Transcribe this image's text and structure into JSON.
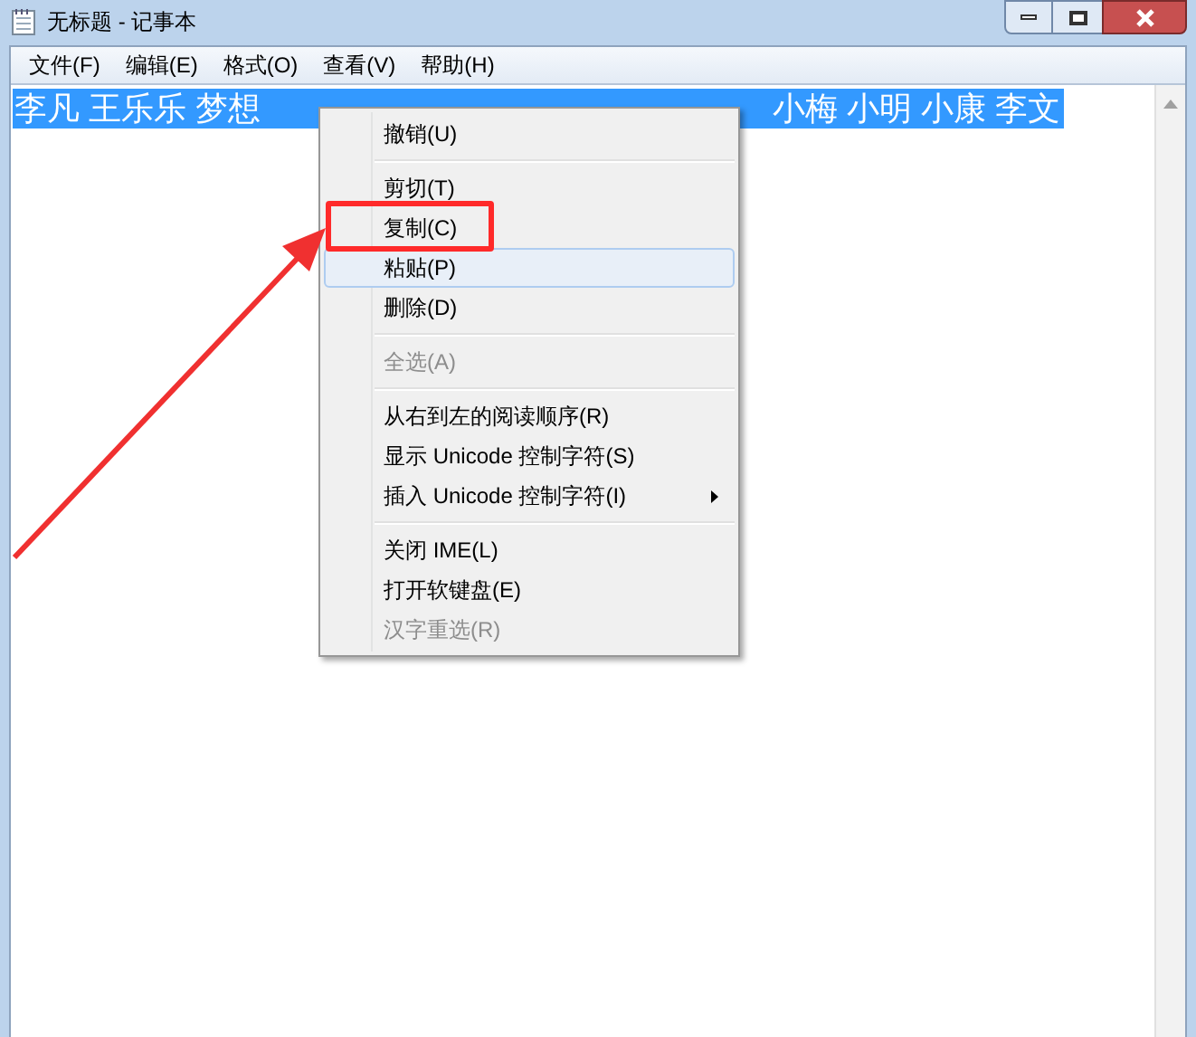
{
  "window": {
    "title": "无标题 - 记事本"
  },
  "menu_bar": [
    "文件(F)",
    "编辑(E)",
    "格式(O)",
    "查看(V)",
    "帮助(H)"
  ],
  "editor": {
    "selected": true,
    "text_segments": [
      "李凡 王乐乐 梦想",
      "小梅 小明 小康 李文"
    ]
  },
  "context_menu": [
    {
      "kind": "item",
      "label": "撤销(U)",
      "disabled": false,
      "selected": false,
      "submenu": false
    },
    {
      "kind": "separator"
    },
    {
      "kind": "item",
      "label": "剪切(T)",
      "disabled": false,
      "selected": false,
      "submenu": false
    },
    {
      "kind": "item",
      "label": "复制(C)",
      "disabled": false,
      "selected": false,
      "submenu": false,
      "annotated": true
    },
    {
      "kind": "item",
      "label": "粘贴(P)",
      "disabled": false,
      "selected": true,
      "submenu": false
    },
    {
      "kind": "item",
      "label": "删除(D)",
      "disabled": false,
      "selected": false,
      "submenu": false
    },
    {
      "kind": "separator"
    },
    {
      "kind": "item",
      "label": "全选(A)",
      "disabled": true,
      "selected": false,
      "submenu": false
    },
    {
      "kind": "separator"
    },
    {
      "kind": "item",
      "label": "从右到左的阅读顺序(R)",
      "disabled": false,
      "selected": false,
      "submenu": false
    },
    {
      "kind": "item",
      "label": "显示 Unicode 控制字符(S)",
      "disabled": false,
      "selected": false,
      "submenu": false
    },
    {
      "kind": "item",
      "label": "插入 Unicode 控制字符(I)",
      "disabled": false,
      "selected": false,
      "submenu": true
    },
    {
      "kind": "separator"
    },
    {
      "kind": "item",
      "label": "关闭 IME(L)",
      "disabled": false,
      "selected": false,
      "submenu": false
    },
    {
      "kind": "item",
      "label": "打开软键盘(E)",
      "disabled": false,
      "selected": false,
      "submenu": false
    },
    {
      "kind": "item",
      "label": "汉字重选(R)",
      "disabled": true,
      "selected": false,
      "submenu": false
    }
  ]
}
